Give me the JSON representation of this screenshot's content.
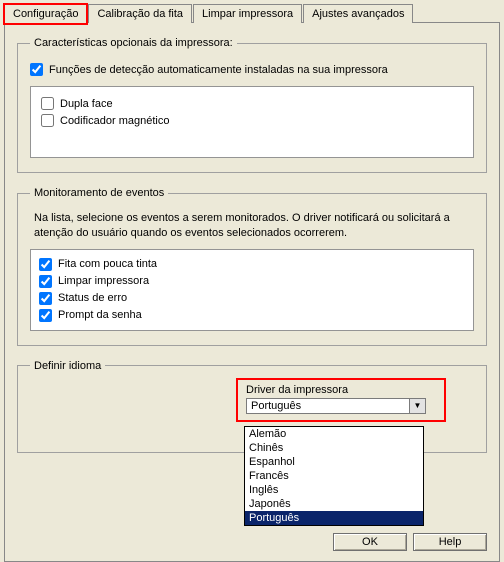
{
  "tabs": {
    "configuracao": "Configuração",
    "calibracao": "Calibração da fita",
    "limpar": "Limpar impressora",
    "ajustes": "Ajustes avançados"
  },
  "section_optional": {
    "legend": "Características opcionais da impressora:",
    "auto_detect": "Funções de detecção automaticamente instaladas na sua impressora",
    "duplex": "Dupla face",
    "mag_encoder": "Codificador magnético"
  },
  "section_events": {
    "legend": "Monitoramento de eventos",
    "description": "Na lista, selecione os eventos a serem monitorados. O driver notificará ou solicitará a atenção do usuário quando os eventos selecionados ocorrerem.",
    "items": {
      "low_ribbon": "Fita com pouca tinta",
      "clean_printer": "Limpar impressora",
      "error_status": "Status de erro",
      "password_prompt": "Prompt da senha"
    }
  },
  "section_language": {
    "legend": "Definir idioma",
    "driver_label": "Driver da impressora",
    "selected": "Português",
    "options": {
      "de": "Alemão",
      "zh": "Chinês",
      "es": "Espanhol",
      "fr": "Francês",
      "en": "Inglês",
      "ja": "Japonês",
      "pt": "Português"
    }
  },
  "buttons": {
    "ok": "OK",
    "help": "Help"
  }
}
